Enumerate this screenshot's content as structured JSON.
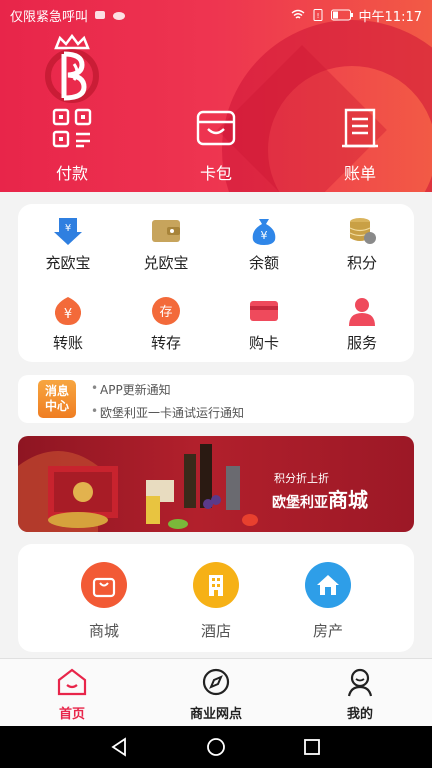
{
  "status_bar": {
    "carrier": "仅限紧急呼叫",
    "time": "中午11:17"
  },
  "quick_actions": [
    {
      "label": "付款",
      "icon": "qr-code-icon"
    },
    {
      "label": "卡包",
      "icon": "wallet-icon"
    },
    {
      "label": "账单",
      "icon": "bill-icon"
    }
  ],
  "grid": [
    {
      "label": "充欧宝",
      "icon": "recharge-icon"
    },
    {
      "label": "兑欧宝",
      "icon": "exchange-wallet-icon"
    },
    {
      "label": "余额",
      "icon": "money-bag-icon"
    },
    {
      "label": "积分",
      "icon": "coins-icon"
    },
    {
      "label": "转账",
      "icon": "transfer-icon"
    },
    {
      "label": "转存",
      "icon": "deposit-icon"
    },
    {
      "label": "购卡",
      "icon": "card-icon"
    },
    {
      "label": "服务",
      "icon": "service-person-icon"
    }
  ],
  "news": {
    "badge_line1": "消息",
    "badge_line2": "中心",
    "items": [
      "APP更新通知",
      "欧堡利亚一卡通试运行通知"
    ]
  },
  "banner": {
    "line1": "积分折上折",
    "line2a": "欧堡利亚",
    "line2b": "商城"
  },
  "services": [
    {
      "label": "商城",
      "icon": "shopping-bag-icon",
      "color": "#f25a35"
    },
    {
      "label": "酒店",
      "icon": "hotel-icon",
      "color": "#f6b116"
    },
    {
      "label": "房产",
      "icon": "house-icon",
      "color": "#2e9ee8"
    }
  ],
  "tabs": [
    {
      "label": "首页",
      "icon": "home-icon",
      "active": true
    },
    {
      "label": "商业网点",
      "icon": "compass-icon",
      "active": false
    },
    {
      "label": "我的",
      "icon": "user-icon",
      "active": false
    }
  ],
  "colors": {
    "accent": "#e8254a"
  }
}
